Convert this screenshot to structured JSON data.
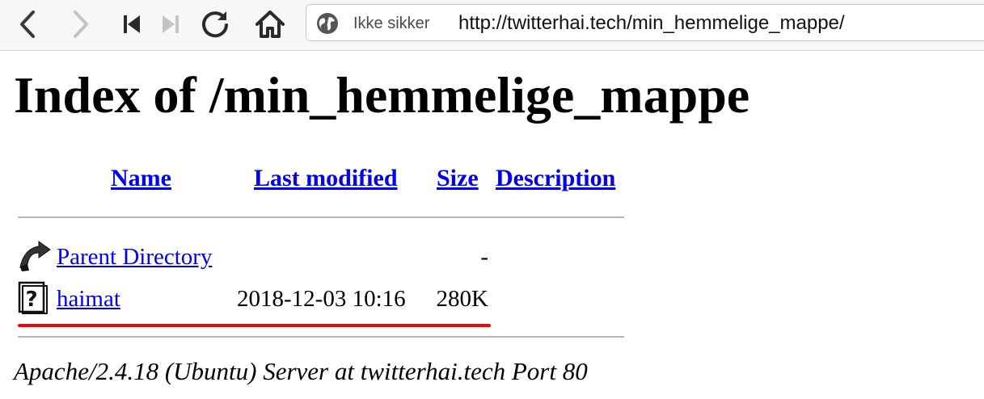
{
  "browser": {
    "security_label": "Ikke sikker",
    "url": "http://twitterhai.tech/min_hemmelige_mappe/"
  },
  "page": {
    "title": "Index of /min_hemmelige_mappe",
    "columns": [
      "Name",
      "Last modified",
      "Size",
      "Description"
    ],
    "rows": [
      {
        "icon": "back-arrow-icon",
        "name": "Parent Directory",
        "modified": "",
        "size": "-",
        "description": ""
      },
      {
        "icon": "unknown-file-icon",
        "name": "haimat",
        "modified": "2018-12-03 10:16",
        "size": "280K",
        "description": ""
      }
    ],
    "footer": "Apache/2.4.18 (Ubuntu) Server at twitterhai.tech Port 80"
  },
  "colors": {
    "link": "#0000ee",
    "highlight": "#ff0000"
  }
}
